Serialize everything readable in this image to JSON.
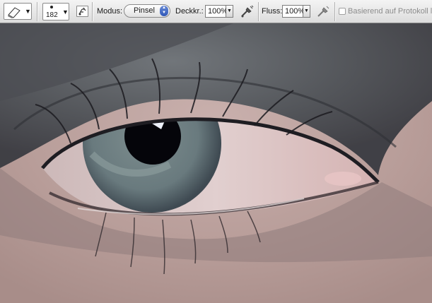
{
  "toolbar": {
    "tool_preset_icon": "eraser-icon",
    "brush_size": "182",
    "brush_panel_icon": "brush-panel-icon",
    "mode_label": "Modus:",
    "mode_value": "Pinsel",
    "opacity_label": "Deckkr.:",
    "opacity_value": "100%",
    "airbrush_icon": "airbrush-icon",
    "flow_label": "Fluss:",
    "flow_value": "100%",
    "tablet_pressure_icon": "tablet-pressure-icon",
    "history_label": "Basierend auf Protokoll lösc"
  },
  "canvas": {
    "subject": "eye-closeup-photo",
    "skin_color": "#c6a9a6",
    "iris_color": "#6f7f84",
    "shadow_color": "#3c3b40"
  }
}
